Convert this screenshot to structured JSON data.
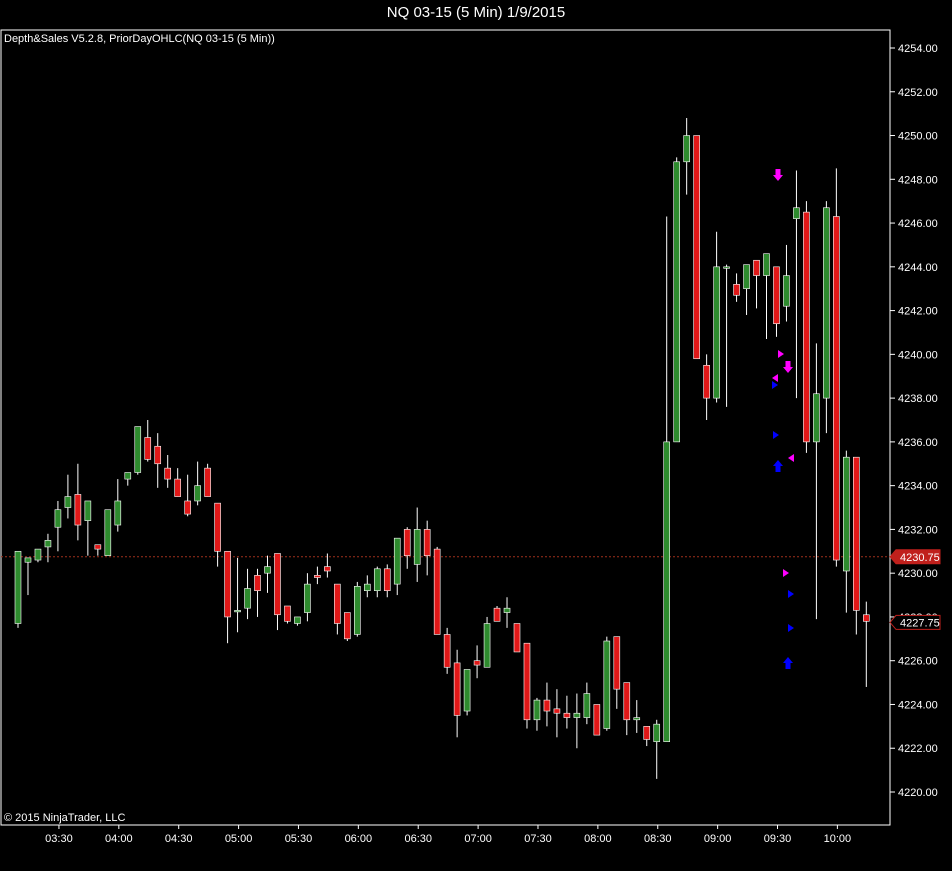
{
  "window": {
    "title": "NQ 03-15 (5 Min)  1/9/2015"
  },
  "chart": {
    "indicator_label": "Depth&Sales V5.2.8, PriorDayOHLC(NQ 03-15 (5 Min))",
    "copyright": "© 2015 NinjaTrader, LLC",
    "colors": {
      "background": "#000000",
      "up_candle": "#2e8b2e",
      "down_candle": "#e01818",
      "wick": "#ffffff",
      "axis": "#ffffff",
      "prior_close_line": "#a0301c",
      "price_marker": "#c0201c",
      "sell_arrow": "#ff00ff",
      "buy_arrow": "#0000ff"
    },
    "price_markers": [
      {
        "label": "4230.75",
        "value": 4230.75,
        "style": "filled"
      },
      {
        "label": "4227.75",
        "value": 4227.75,
        "style": "outline"
      }
    ]
  },
  "chart_data": {
    "type": "candlestick",
    "title": "NQ 03-15 (5 Min)  1/9/2015",
    "ylim": [
      4218.5,
      4255
    ],
    "y_ticks": [
      "4220.00",
      "4222.00",
      "4224.00",
      "4226.00",
      "4228.00",
      "4230.00",
      "4232.00",
      "4234.00",
      "4236.00",
      "4238.00",
      "4240.00",
      "4242.00",
      "4244.00",
      "4246.00",
      "4248.00",
      "4250.00",
      "4252.00",
      "4254.00"
    ],
    "x_ticks": [
      {
        "label": "03:30",
        "bar": 3
      },
      {
        "label": "04:00",
        "bar": 9
      },
      {
        "label": "04:30",
        "bar": 15
      },
      {
        "label": "05:00",
        "bar": 21
      },
      {
        "label": "05:30",
        "bar": 27
      },
      {
        "label": "06:00",
        "bar": 33
      },
      {
        "label": "06:30",
        "bar": 39
      },
      {
        "label": "07:00",
        "bar": 45
      },
      {
        "label": "07:30",
        "bar": 51
      },
      {
        "label": "08:00",
        "bar": 57
      },
      {
        "label": "08:30",
        "bar": 63
      },
      {
        "label": "09:00",
        "bar": 69
      },
      {
        "label": "09:30",
        "bar": 75
      },
      {
        "label": "10:00",
        "bar": 81
      }
    ],
    "prior_day_line": 4230.75,
    "bars": [
      [
        4227.7,
        4231,
        4227.5,
        4231
      ],
      [
        4230.5,
        4230.5,
        4229,
        4230.7
      ],
      [
        4230.6,
        4231.1,
        4230.5,
        4231.1
      ],
      [
        4231.2,
        4231.8,
        4230.5,
        4231.5
      ],
      [
        4232.1,
        4233.3,
        4231,
        4232.9
      ],
      [
        4233,
        4234.5,
        4232.5,
        4233.5
      ],
      [
        4233.6,
        4235,
        4231.5,
        4232.2
      ],
      [
        4232.4,
        4233.1,
        4230.8,
        4233.3
      ],
      [
        4231.3,
        4231.3,
        4230.8,
        4231.1
      ],
      [
        4230.8,
        4232.9,
        4230.8,
        4232.9
      ],
      [
        4232.2,
        4234.3,
        4231.9,
        4233.3
      ],
      [
        4234.3,
        4234.5,
        4234,
        4234.6
      ],
      [
        4234.6,
        4236.6,
        4234.5,
        4236.7
      ],
      [
        4236.2,
        4237,
        4235.1,
        4235.2
      ],
      [
        4235.8,
        4236.4,
        4233.9,
        4235
      ],
      [
        4234.8,
        4235.4,
        4233.9,
        4234.3
      ],
      [
        4234.3,
        4234.8,
        4233.5,
        4233.5
      ],
      [
        4233.3,
        4234.5,
        4232.6,
        4232.7
      ],
      [
        4233.3,
        4235.1,
        4233.1,
        4234
      ],
      [
        4234.8,
        4235,
        4233.5,
        4233.5
      ],
      [
        4233.2,
        4233.2,
        4230.3,
        4231
      ],
      [
        4231,
        4231,
        4226.8,
        4228
      ],
      [
        4228.3,
        4230.7,
        4227.3,
        4228.3
      ],
      [
        4228.4,
        4230.2,
        4227.9,
        4229.3
      ],
      [
        4229.9,
        4230.2,
        4228,
        4229.2
      ],
      [
        4230,
        4230.8,
        4229.1,
        4230.3
      ],
      [
        4230.9,
        4230.9,
        4227.4,
        4228.1
      ],
      [
        4228.5,
        4228.5,
        4227.7,
        4227.8
      ],
      [
        4227.7,
        4228,
        4227.6,
        4228
      ],
      [
        4228.2,
        4230,
        4227.8,
        4229.5
      ],
      [
        4229.9,
        4230.3,
        4229.5,
        4229.8
      ],
      [
        4230.3,
        4230.9,
        4229.8,
        4230.1
      ],
      [
        4229.5,
        4229.5,
        4227.2,
        4227.7
      ],
      [
        4228.2,
        4228.2,
        4226.9,
        4227
      ],
      [
        4227.2,
        4229.6,
        4227.1,
        4229.4
      ],
      [
        4229.2,
        4229.9,
        4228.9,
        4229.5
      ],
      [
        4229.2,
        4230.3,
        4228.9,
        4230.2
      ],
      [
        4230.2,
        4230.4,
        4228.9,
        4229.2
      ],
      [
        4229.5,
        4231.6,
        4229,
        4231.6
      ],
      [
        4232,
        4232.1,
        4230.2,
        4230.8
      ],
      [
        4230.4,
        4233,
        4229.6,
        4232
      ],
      [
        4232,
        4232.4,
        4229.9,
        4230.8
      ],
      [
        4231.1,
        4231.2,
        4227.2,
        4227.2
      ],
      [
        4227.2,
        4227.5,
        4225.4,
        4225.7
      ],
      [
        4225.9,
        4226.5,
        4222.5,
        4223.5
      ],
      [
        4223.7,
        4225.2,
        4223.5,
        4225.6
      ],
      [
        4226,
        4226.7,
        4225.2,
        4225.8
      ],
      [
        4225.7,
        4228,
        4225.7,
        4227.7
      ],
      [
        4228.4,
        4228.5,
        4228.4,
        4227.8
      ],
      [
        4228.2,
        4228.9,
        4227.5,
        4228.4
      ],
      [
        4227.7,
        4227.7,
        4226.5,
        4226.4
      ],
      [
        4226.8,
        4226.8,
        4222.9,
        4223.3
      ],
      [
        4223.3,
        4224.3,
        4222.8,
        4224.2
      ],
      [
        4224.2,
        4225,
        4223,
        4223.7
      ],
      [
        4223.8,
        4224.7,
        4222.5,
        4223.6
      ],
      [
        4223.6,
        4224.4,
        4222.9,
        4223.4
      ],
      [
        4223.4,
        4224.5,
        4222,
        4223.6
      ],
      [
        4223.4,
        4225,
        4223.1,
        4224.5
      ],
      [
        4224,
        4224,
        4222.6,
        4222.6
      ],
      [
        4222.9,
        4227.1,
        4222.8,
        4226.9
      ],
      [
        4227.1,
        4227.1,
        4223.8,
        4224.7
      ],
      [
        4225,
        4225,
        4222.6,
        4223.3
      ],
      [
        4223.3,
        4224.2,
        4222.7,
        4223.4
      ],
      [
        4223,
        4223,
        4222.1,
        4222.4
      ],
      [
        4222.3,
        4223.3,
        4220.6,
        4223.1
      ],
      [
        4222.3,
        4246.3,
        4222.3,
        4236
      ],
      [
        4236,
        4249,
        4236,
        4248.8
      ],
      [
        4248.8,
        4250.8,
        4247.3,
        4250
      ],
      [
        4250,
        4250,
        4240,
        4239.8
      ],
      [
        4239.5,
        4240,
        4237,
        4238
      ],
      [
        4238,
        4245.6,
        4237.8,
        4244
      ],
      [
        4244,
        4244.1,
        4237.6,
        4244
      ],
      [
        4243.2,
        4243.7,
        4242.4,
        4242.7
      ],
      [
        4243,
        4243.5,
        4241.8,
        4244.1
      ],
      [
        4244.3,
        4244.3,
        4242.1,
        4243.6
      ],
      [
        4243.6,
        4244.6,
        4240.7,
        4244.6
      ],
      [
        4244,
        4244,
        4240.8,
        4241.4
      ],
      [
        4242.2,
        4245,
        4241.5,
        4243.6
      ],
      [
        4246.2,
        4248.4,
        4238,
        4246.7
      ],
      [
        4246.5,
        4247,
        4235.5,
        4236
      ],
      [
        4236,
        4240.5,
        4227.9,
        4238.2
      ],
      [
        4238,
        4247,
        4236.4,
        4246.7
      ],
      [
        4246.3,
        4248.5,
        4230.3,
        4230.6
      ],
      [
        4230.1,
        4235.6,
        4228.2,
        4235.3
      ],
      [
        4235.3,
        4235.3,
        4227.2,
        4228.3
      ],
      [
        4228.1,
        4228.7,
        4224.8,
        4227.8
      ]
    ]
  }
}
